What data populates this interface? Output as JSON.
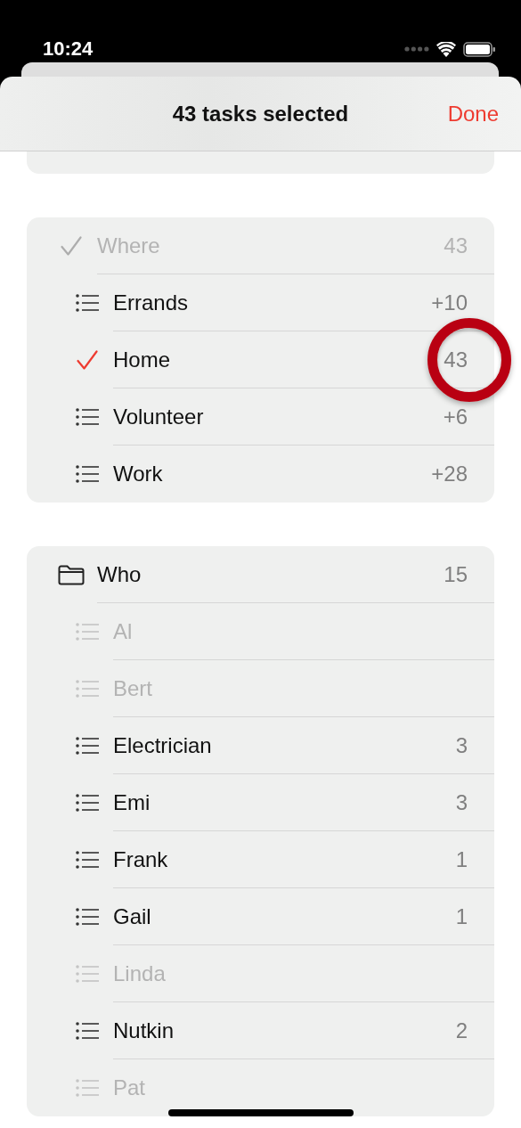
{
  "status_bar": {
    "time": "10:24"
  },
  "header": {
    "title": "43 tasks selected",
    "done": "Done"
  },
  "sections": [
    {
      "rows": [
        {
          "kind": "check",
          "label": "Where",
          "count": "43",
          "disabled": true,
          "children": [
            {
              "kind": "list",
              "label": "Errands",
              "count": "+10",
              "disabled": false
            },
            {
              "kind": "check",
              "label": "Home",
              "count": "43",
              "disabled": false,
              "highlighted": true
            },
            {
              "kind": "list",
              "label": "Volunteer",
              "count": "+6",
              "disabled": false
            },
            {
              "kind": "list",
              "label": "Work",
              "count": "+28",
              "disabled": false
            }
          ]
        }
      ]
    },
    {
      "rows": [
        {
          "kind": "folder",
          "label": "Who",
          "count": "15",
          "disabled": false,
          "children": [
            {
              "kind": "list",
              "label": "Al",
              "disabled": true
            },
            {
              "kind": "list",
              "label": "Bert",
              "disabled": true
            },
            {
              "kind": "list",
              "label": "Electrician",
              "count": "3",
              "disabled": false
            },
            {
              "kind": "list",
              "label": "Emi",
              "count": "3",
              "disabled": false
            },
            {
              "kind": "list",
              "label": "Frank",
              "count": "1",
              "disabled": false
            },
            {
              "kind": "list",
              "label": "Gail",
              "count": "1",
              "disabled": false
            },
            {
              "kind": "list",
              "label": "Linda",
              "disabled": true
            },
            {
              "kind": "list",
              "label": "Nutkin",
              "count": "2",
              "disabled": false
            },
            {
              "kind": "list",
              "label": "Pat",
              "disabled": true
            }
          ]
        }
      ]
    }
  ]
}
